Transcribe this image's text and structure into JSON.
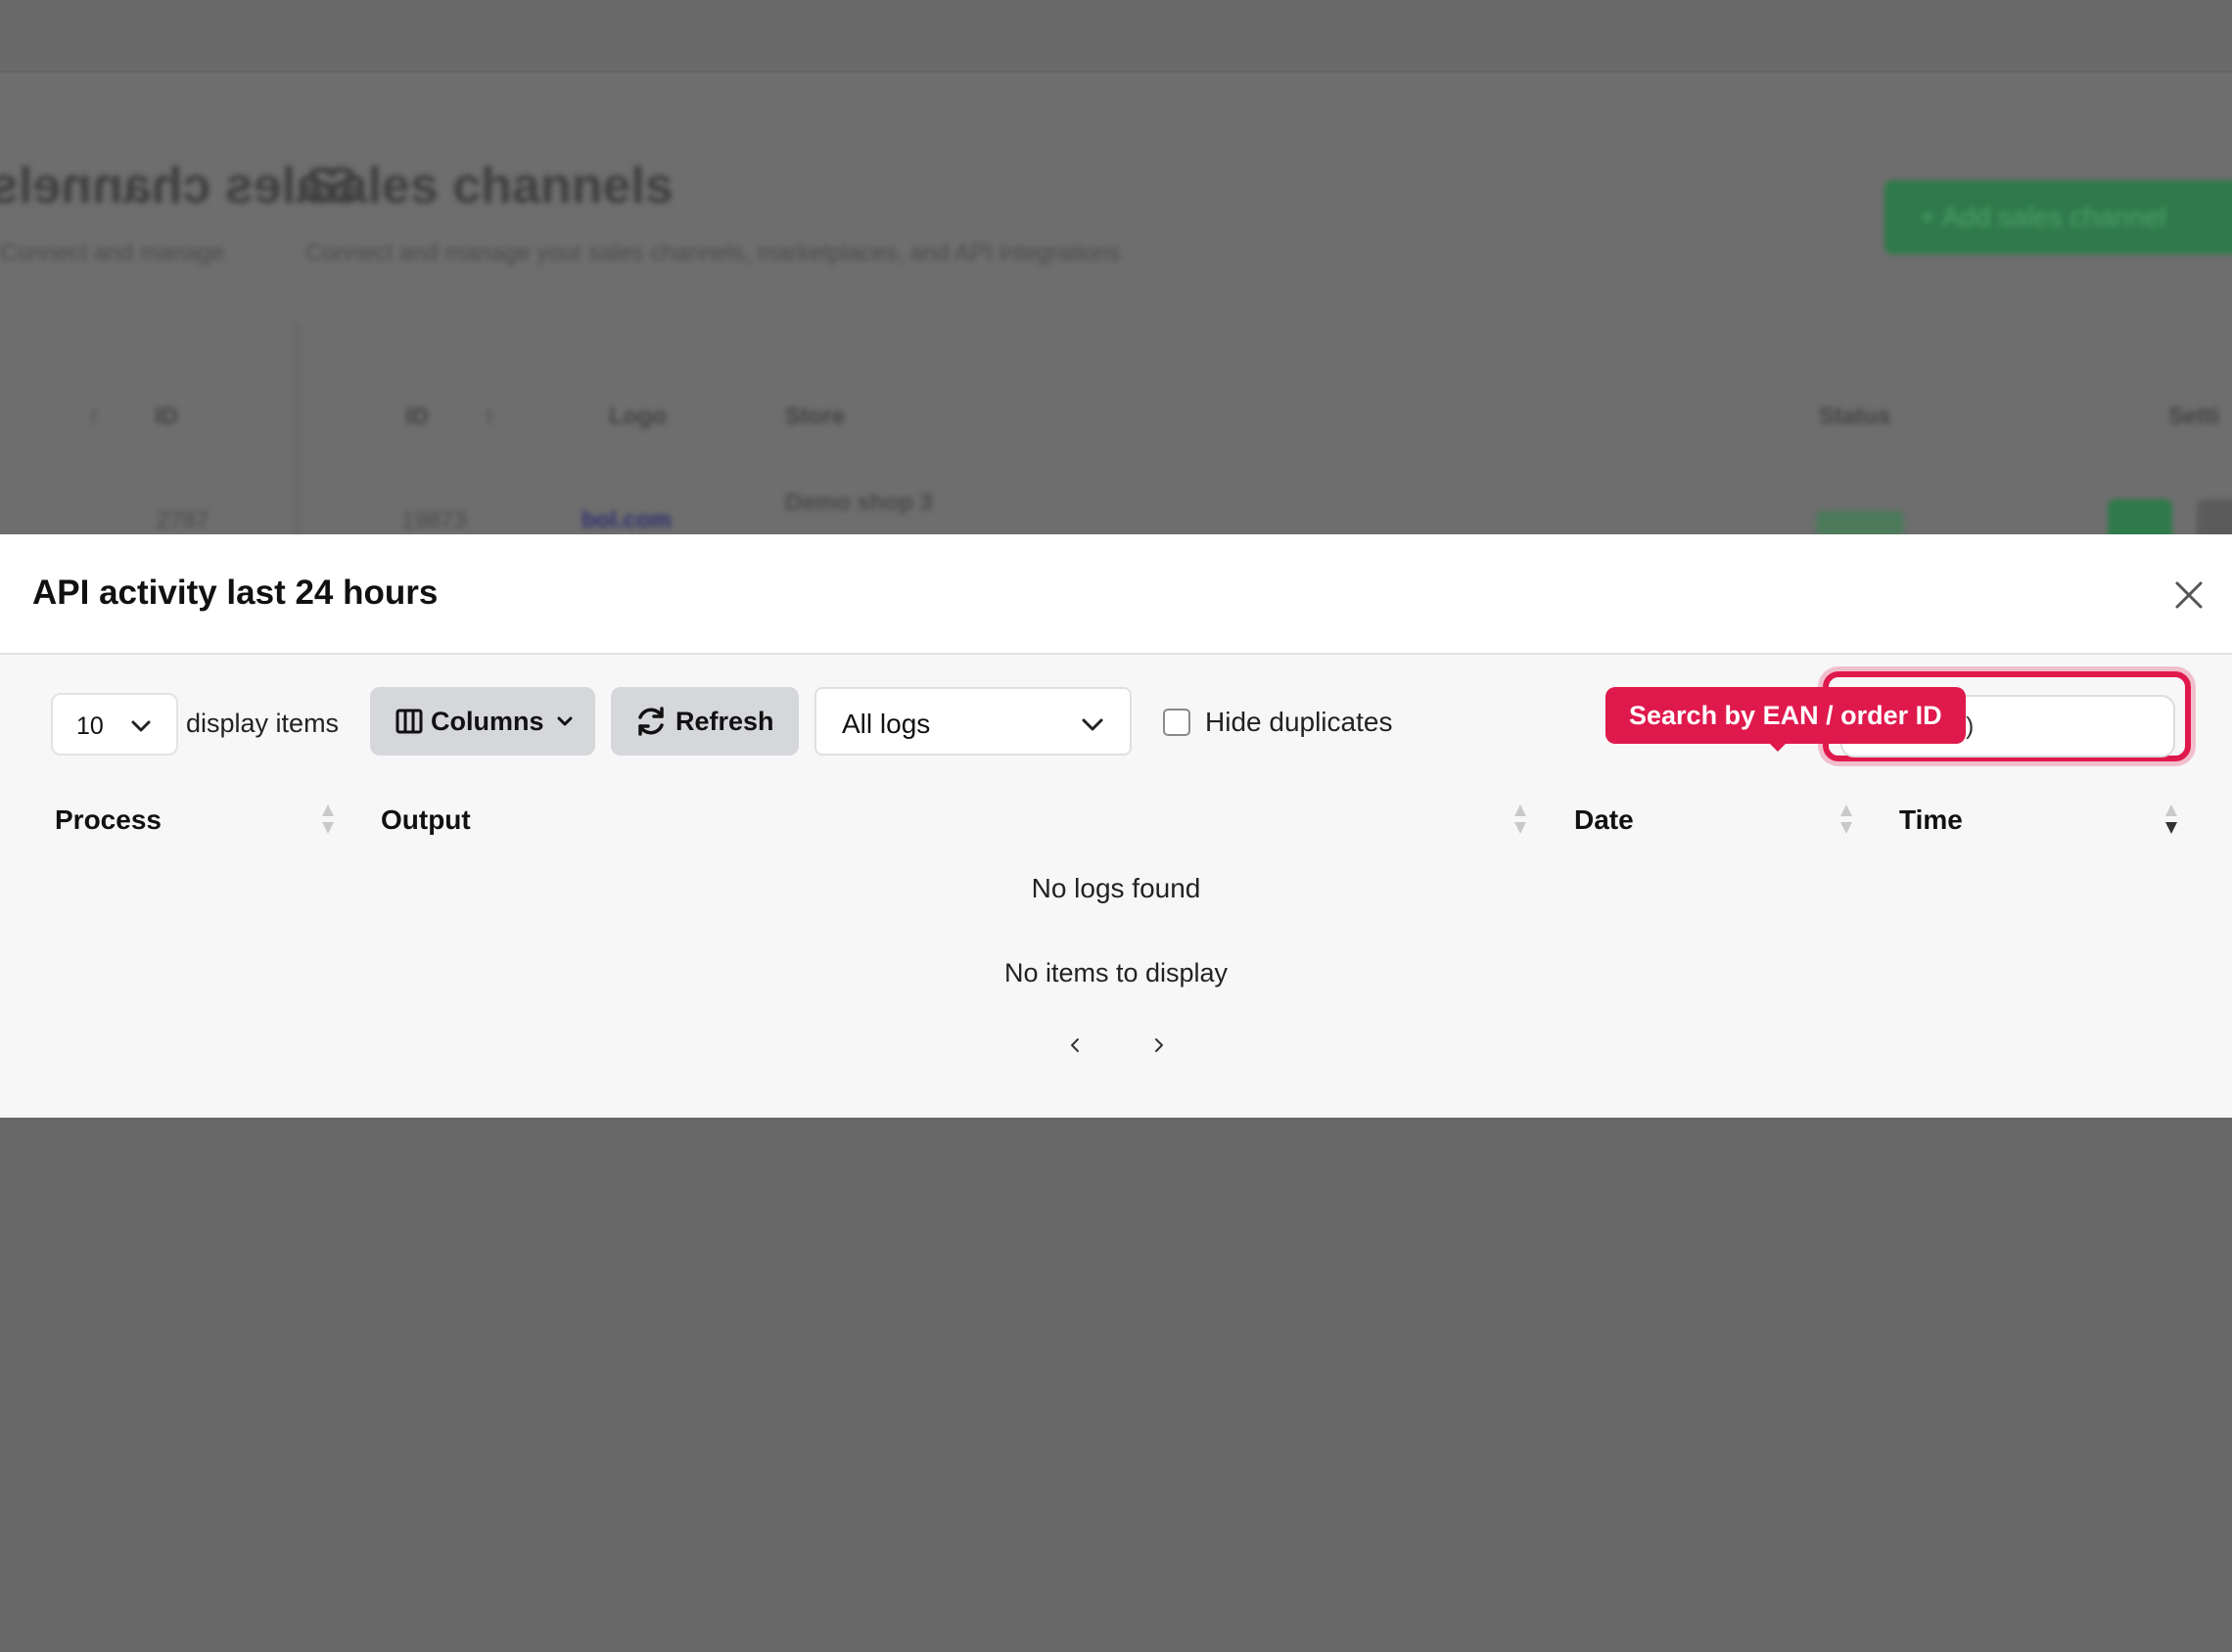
{
  "background": {
    "title": "Sales channels",
    "title_mirrored": "Sales channels",
    "subtitle": "Connect and manage your sales channels, marketplaces, and API integrations",
    "subtitle_mirrored": "Connect and manage",
    "add_button": "+ Add sales channel",
    "left_columns": [
      "↑",
      "ID"
    ],
    "columns": [
      "ID",
      "↑",
      "Logo",
      "Store",
      "Status",
      "Setti"
    ],
    "row": {
      "left_id": "2787",
      "id": "19873",
      "logo": "bol.com",
      "store": "Demo shop 3"
    }
  },
  "modal": {
    "title": "API activity last 24 hours",
    "toolbar": {
      "per_page_value": "10",
      "per_page_label": "display items",
      "columns_label": "Columns",
      "refresh_label": "Refresh",
      "log_filter_value": "All logs",
      "hide_duplicates_label": "Hide duplicates",
      "search_value": ")",
      "search_tooltip": "Search by EAN / order ID"
    },
    "table": {
      "headers": [
        "Process",
        "Output",
        "Date",
        "Time"
      ],
      "empty_message": "No logs found",
      "empty_items": "No items to display"
    },
    "pager": {
      "prev": "‹",
      "next": "›"
    }
  },
  "colors": {
    "accent_red": "#e0194d",
    "button_grey": "#d5d7db",
    "overlay": "#676767"
  }
}
